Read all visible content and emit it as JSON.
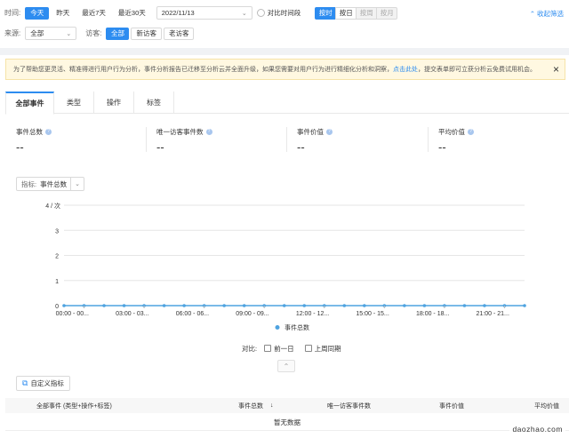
{
  "filters": {
    "time_label": "时间:",
    "quick_ranges": [
      "今天",
      "昨天",
      "最近7天",
      "最近30天"
    ],
    "date_value": "2022/11/13",
    "compare_label": "对比时间段",
    "granularity": [
      "按时",
      "按日",
      "按周",
      "按月"
    ],
    "collapse_label": "收起筛选",
    "source_label": "来源:",
    "source_value": "全部",
    "visitor_label": "访客:",
    "visitor_options": [
      "全部",
      "新访客",
      "老访客"
    ]
  },
  "notice": {
    "text_before": "为了帮助您更灵活、精准得进行用户行为分析，事件分析报告已迁移至分析云并全面升级，如果您需要对用户行为进行精细化分析和洞察，",
    "link": "点击此处",
    "text_after": "，提交表单即可立获分析云免费试用机会。",
    "close": "×"
  },
  "tabs": [
    "全部事件",
    "类型",
    "操作",
    "标签"
  ],
  "metrics": [
    {
      "title": "事件总数",
      "value": "--"
    },
    {
      "title": "唯一访客事件数",
      "value": "--"
    },
    {
      "title": "事件价值",
      "value": "--"
    },
    {
      "title": "平均价值",
      "value": "--"
    }
  ],
  "indicator": {
    "label": "指标:",
    "value": "事件总数"
  },
  "chart_data": {
    "type": "line",
    "y_unit_label": "4 / 次",
    "yticks": [
      "3",
      "2",
      "1",
      "0"
    ],
    "ylim": [
      0,
      4
    ],
    "x_tick_labels": [
      "00:00 - 00...",
      "03:00 - 03...",
      "06:00 - 06...",
      "09:00 - 09...",
      "12:00 - 12...",
      "15:00 - 15...",
      "18:00 - 18...",
      "21:00 - 21..."
    ],
    "points_count": 24,
    "series": [
      {
        "name": "事件总数",
        "color": "#4fa3e0",
        "values": [
          0,
          0,
          0,
          0,
          0,
          0,
          0,
          0,
          0,
          0,
          0,
          0,
          0,
          0,
          0,
          0,
          0,
          0,
          0,
          0,
          0,
          0,
          0,
          0
        ]
      }
    ],
    "grid": true,
    "legend": "bottom"
  },
  "compare": {
    "label": "对比:",
    "options": [
      "前一日",
      "上周同期"
    ]
  },
  "custom_metric_button": "自定义指标",
  "table": {
    "headers": [
      "全部事件 (类型+操作+标签)",
      "事件总数",
      "唯一访客事件数",
      "事件价值",
      "平均价值"
    ],
    "sort_icon": "↓",
    "empty": "暂无数据"
  },
  "watermark": "daozhao.com",
  "colors": {
    "accent": "#2d8cf0",
    "line": "#4fa3e0"
  }
}
